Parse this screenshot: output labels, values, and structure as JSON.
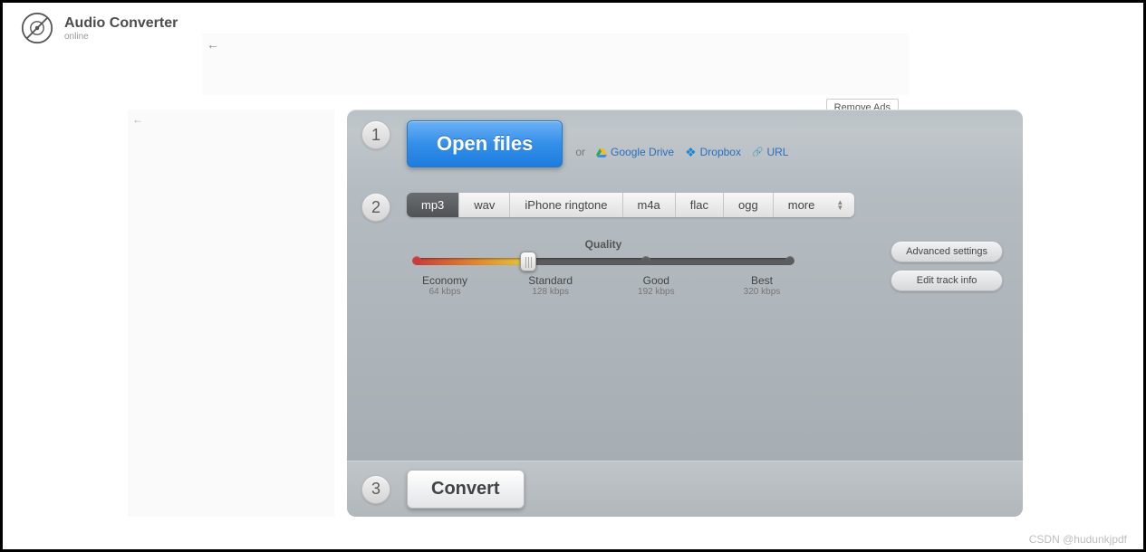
{
  "app": {
    "title": "Audio Converter",
    "subtitle": "online"
  },
  "remove_ads": "Remove Ads",
  "step1": {
    "num": "1",
    "open_files": "Open files",
    "or": "or",
    "google_drive": "Google Drive",
    "dropbox": "Dropbox",
    "url": "URL"
  },
  "step2": {
    "num": "2",
    "formats": {
      "mp3": "mp3",
      "wav": "wav",
      "iphone": "iPhone ringtone",
      "m4a": "m4a",
      "flac": "flac",
      "ogg": "ogg",
      "more": "more"
    },
    "quality_label": "Quality",
    "presets": {
      "economy": {
        "name": "Economy",
        "rate": "64 kbps"
      },
      "standard": {
        "name": "Standard",
        "rate": "128 kbps"
      },
      "good": {
        "name": "Good",
        "rate": "192 kbps"
      },
      "best": {
        "name": "Best",
        "rate": "320 kbps"
      }
    },
    "advanced": "Advanced settings",
    "edit_track": "Edit track info"
  },
  "step3": {
    "num": "3",
    "convert": "Convert"
  },
  "watermark": "CSDN @hudunkjpdf"
}
